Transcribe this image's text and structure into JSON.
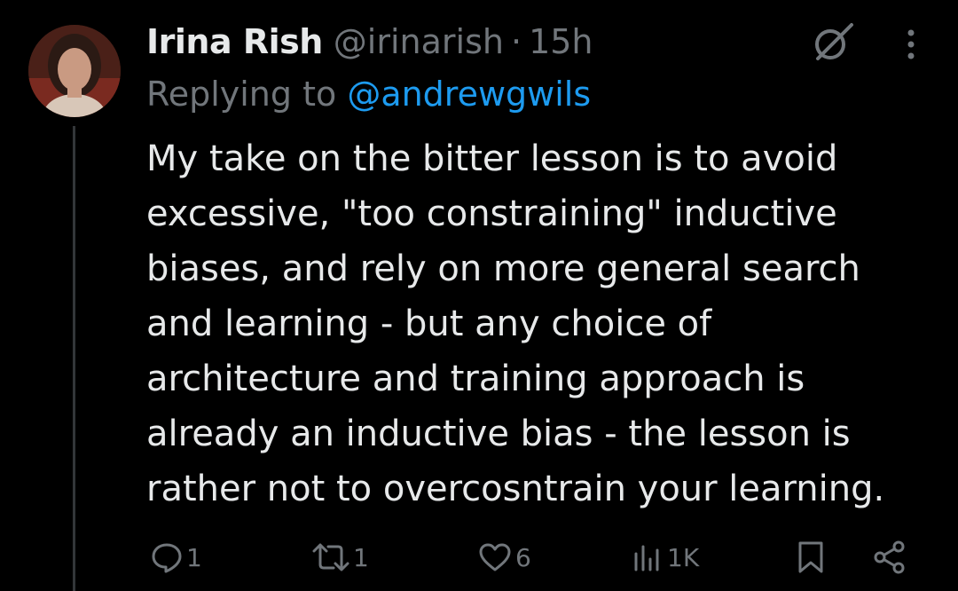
{
  "tweet": {
    "author": {
      "display_name": "Irina Rish",
      "handle": "@irinarish",
      "separator": "·",
      "time": "15h"
    },
    "reply": {
      "prefix": "Replying to ",
      "handle": "@andrewgwils"
    },
    "body_lines": [
      "My take on the bitter lesson is to avoid",
      "excessive, \"too constraining\" inductive",
      "biases, and rely on more general search",
      "and learning - but any choice of",
      "architecture and training approach is",
      "already an inductive bias - the lesson is",
      "rather not to overcosntrain your learning."
    ],
    "actions": {
      "replies": "1",
      "reposts": "1",
      "likes": "6",
      "views": "1K"
    },
    "icons": {
      "grok": "grok-icon",
      "more": "more-vertical-icon",
      "reply": "reply-icon",
      "repost": "repost-icon",
      "like": "heart-icon",
      "views": "views-icon",
      "bookmark": "bookmark-icon",
      "share": "share-icon"
    },
    "colors": {
      "background": "#000000",
      "text": "#e7e9ea",
      "secondary": "#71767b",
      "link": "#1d9bf0"
    }
  }
}
